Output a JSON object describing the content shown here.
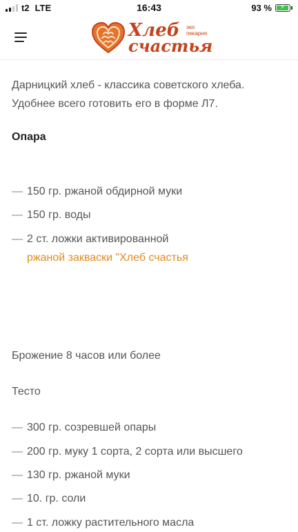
{
  "status_bar": {
    "carrier": "t2",
    "network": "LTE",
    "time": "16:43",
    "battery_percent": "93 %",
    "battery_level": 0.93
  },
  "header": {
    "logo_title_line1": "Хлеб",
    "logo_title_line2": "счастья",
    "logo_tagline_line1": "эко",
    "logo_tagline_line2": "пекарня",
    "brand_color": "#c5421c",
    "menu_icon": "hamburger-menu-icon"
  },
  "article": {
    "intro": "Дарницкий хлеб - классика советского хлеба. Удобнее всего готовить его в форме Л7.",
    "starter_heading": "Опара",
    "starter_items": [
      "150 гр. ржаной обдирной муки",
      "150 гр. воды",
      "2 ст. ложки  активированной"
    ],
    "starter_link": "ржаной закваски \"Хлеб счастья",
    "link_color": "#e08a1e",
    "fermentation": "Брожение 8 часов или более",
    "dough_heading": "Тесто",
    "dough_items": [
      "300 гр. созревшей опары",
      "200 гр. муку 1 сорта, 2 сорта или высшего",
      "130 гр. ржаной муки",
      "10. гр. соли",
      "1 ст. ложку растительного масла"
    ],
    "dash": "—"
  }
}
